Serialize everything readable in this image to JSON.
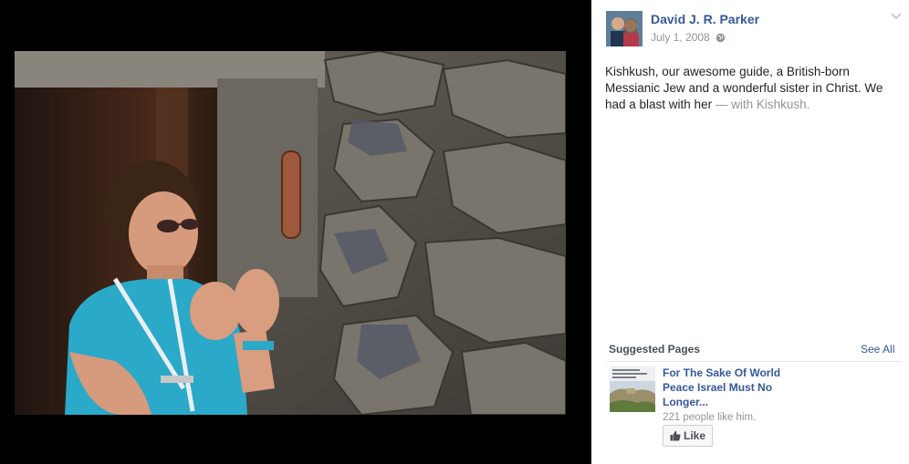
{
  "post": {
    "author_name": "David J. R. Parker",
    "date": "July 1, 2008",
    "privacy_icon": "globe-icon",
    "caption_text": "Kishkush, our awesome guide, a British-born Messianic Jew and a wonderful sister in Christ. We had a blast with her",
    "caption_with": " — with Kishkush."
  },
  "suggested": {
    "header": "Suggested Pages",
    "see_all": "See All",
    "page": {
      "title": "For The Sake Of World Peace Israel Must No Longer...",
      "likes": "221 people like him.",
      "like_label": "Like"
    }
  },
  "colors": {
    "link": "#365899",
    "meta": "#90949c",
    "shirt": "#2aa9c9"
  }
}
